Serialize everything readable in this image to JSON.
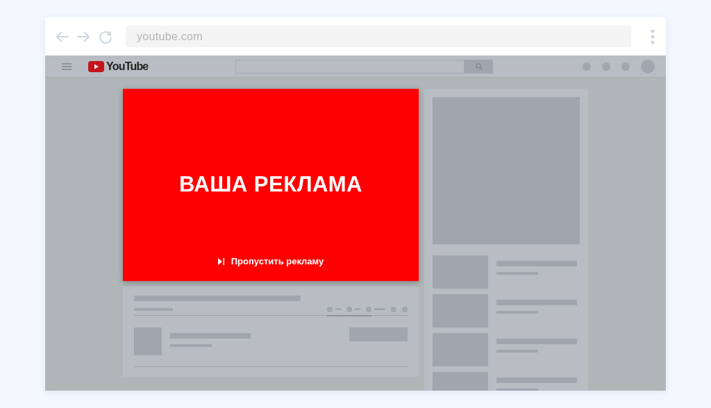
{
  "browser": {
    "address": "youtube.com"
  },
  "site": {
    "logo_text": "YouTube"
  },
  "ad": {
    "title": "ВАША РЕКЛАМА",
    "skip_label": "Пропустить рекламу"
  }
}
